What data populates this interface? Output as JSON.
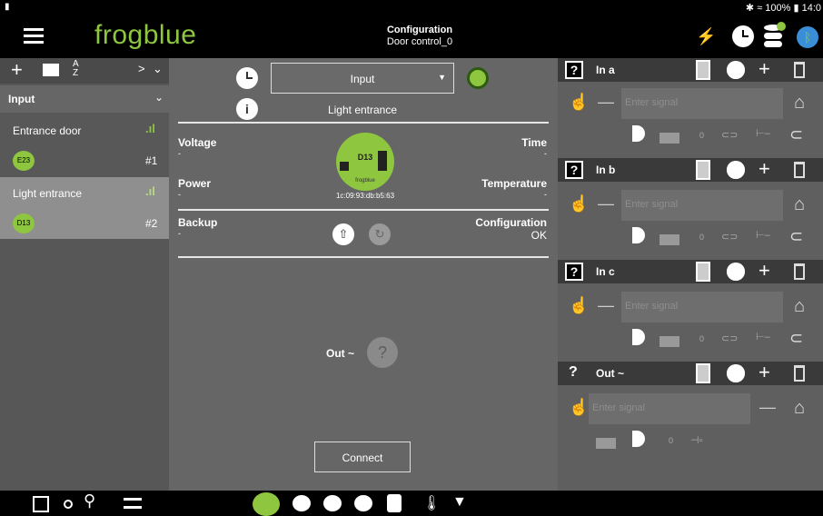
{
  "status": {
    "text": "✱ ≈ 100% ▮ 14:0"
  },
  "app": {
    "logo": "frogblue",
    "title": "Configuration",
    "subtitle": "Door control_0"
  },
  "left": {
    "section": "Input",
    "devices": [
      {
        "name": "Entrance door",
        "badge": "E23",
        "num": "#1"
      },
      {
        "name": "Light entrance",
        "badge": "D13",
        "num": "#2"
      }
    ]
  },
  "center": {
    "select_value": "Input",
    "device_name": "Light entrance",
    "voltage_label": "Voltage",
    "voltage_value": "-",
    "time_label": "Time",
    "time_value": "-",
    "power_label": "Power",
    "power_value": "-",
    "temp_label": "Temperature",
    "temp_value": "-",
    "backup_label": "Backup",
    "backup_value": "-",
    "config_label": "Configuration",
    "config_value": "OK",
    "chip_label": "D13",
    "chip_brand": "frogblue",
    "mac": "1c:09:93:db:b5:63",
    "out_label": "Out ~",
    "connect_label": "Connect"
  },
  "right": {
    "sections": [
      {
        "label": "In a",
        "placeholder": "Enter signal",
        "value": "0"
      },
      {
        "label": "In b",
        "placeholder": "Enter signal",
        "value": "0"
      },
      {
        "label": "In c",
        "placeholder": "Enter signal",
        "value": "0"
      },
      {
        "label": "Out ~",
        "placeholder": "Enter signal",
        "value": "0"
      }
    ]
  },
  "colors": {
    "accent": "#8ec63f",
    "dark": "#000000"
  }
}
